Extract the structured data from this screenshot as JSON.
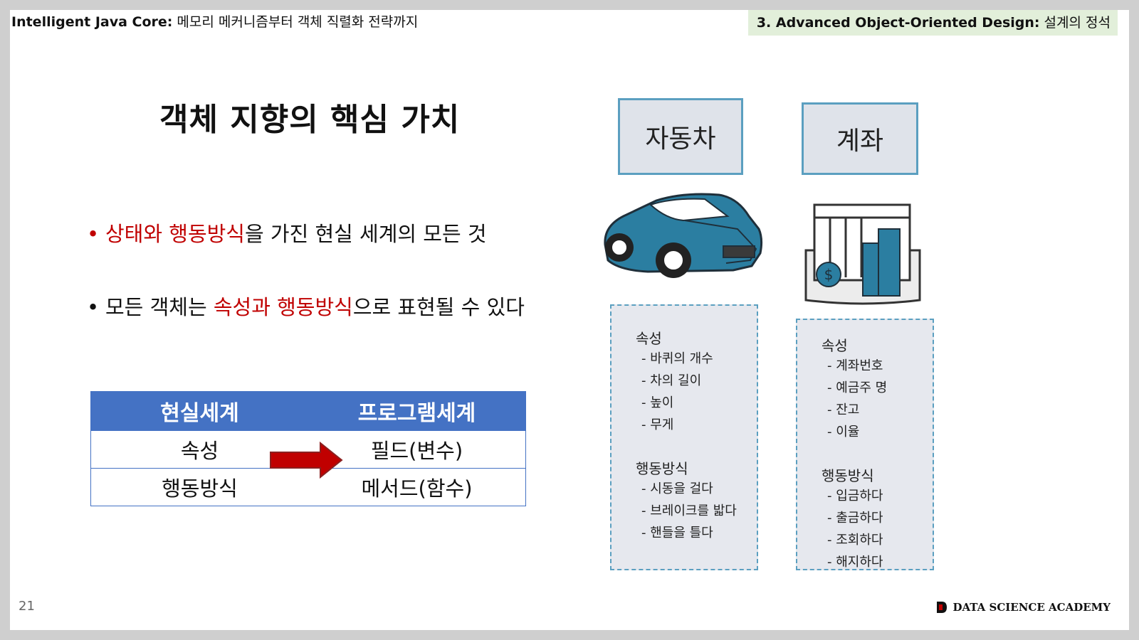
{
  "header": {
    "left_bold": "Intelligent Java Core:",
    "left_rest": " 메모리 메커니즘부터 객체 직렬화 전략까지",
    "right_bold": "3. Advanced Object-Oriented Design:",
    "right_rest": " 설계의 정석"
  },
  "title": "객체 지향의 핵심 가치",
  "bullets": [
    {
      "dot": "•",
      "red1": "상태와 행동방식",
      "text1": "을 가진 현실 세계의 모든 것",
      "pre": ""
    },
    {
      "dot": "•",
      "pre": "모든 객체는 ",
      "red1": "속성과 행동방식",
      "text1": "으로 표현될 수 있다"
    }
  ],
  "table": {
    "headers": [
      "현실세계",
      "프로그램세계"
    ],
    "rows": [
      [
        "속성",
        "필드(변수)"
      ],
      [
        "행동방식",
        "메서드(함수)"
      ]
    ]
  },
  "illustration": {
    "car": {
      "label": "자동차",
      "attr_heading": "속성",
      "attrs": [
        "- 바퀴의 개수",
        "- 차의 길이",
        "- 높이",
        "- 무게"
      ],
      "behavior_heading": "행동방식",
      "behaviors": [
        "- 시동을 걸다",
        "- 브레이크를 밟다",
        "- 핸들을 틀다"
      ]
    },
    "account": {
      "label": "계좌",
      "attr_heading": "속성",
      "attrs": [
        "- 계좌번호",
        "- 예금주 명",
        "- 잔고",
        "- 이율"
      ],
      "behavior_heading": "행동방식",
      "behaviors": [
        "- 입금하다",
        "- 출금하다",
        "- 조회하다",
        "- 해지하다"
      ]
    }
  },
  "footer": {
    "page": "21",
    "logo_text": "DATA SCIENCE ACADEMY"
  },
  "colors": {
    "accent_red": "#c00000",
    "table_blue": "#4472c4",
    "header_green": "#e2efda",
    "car_blue": "#2b7ea1"
  }
}
